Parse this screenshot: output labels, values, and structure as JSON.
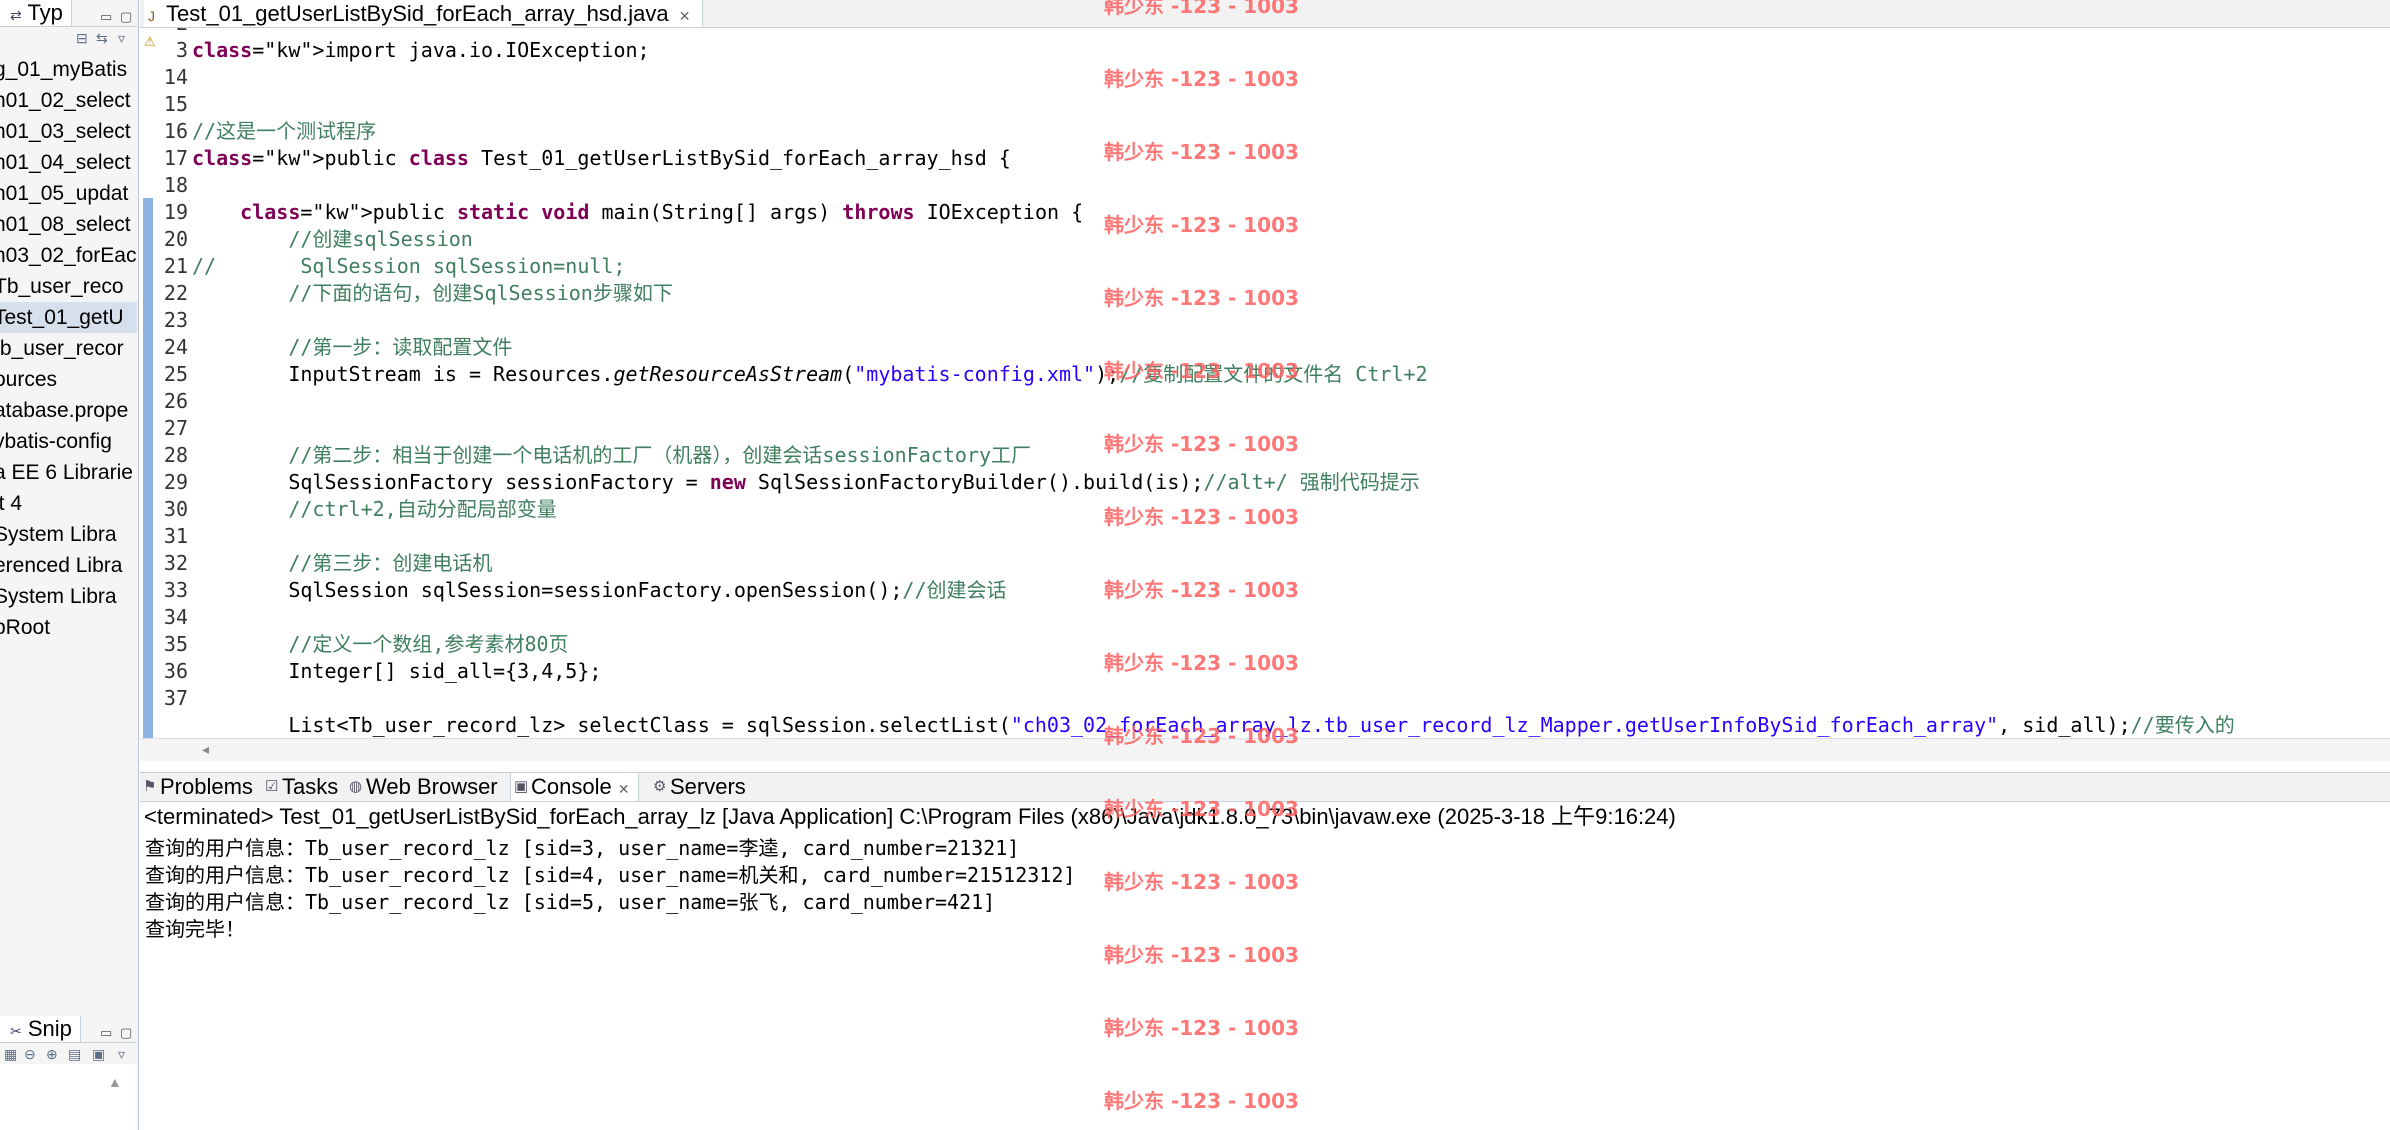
{
  "left_panel": {
    "type_tab": "Typ",
    "tree": [
      "g_01_myBatis",
      "n01_02_select",
      "n01_03_select",
      "n01_04_select",
      "n01_05_updat",
      "n01_08_select",
      "n03_02_forEac",
      "Tb_user_reco",
      "Test_01_getU",
      "tb_user_recor",
      "ources",
      "atabase.prope",
      "ybatis-config",
      "a EE 6 Librarie",
      "it 4",
      "System Libra",
      "erenced Libra",
      "System Libra",
      "bRoot"
    ],
    "selected_index": 8,
    "snip_tab": "Snip"
  },
  "editor": {
    "tab_title": "Test_01_getUserListBySid_forEach_array_hsd.java",
    "line_numbers": [
      "2",
      "3",
      "14",
      "15",
      "16",
      "17",
      "18",
      "19",
      "20",
      "21",
      "22",
      "23",
      "24",
      "25",
      "26",
      "27",
      "28",
      "29",
      "30",
      "31",
      "32",
      "33",
      "34",
      "35",
      "36",
      "37"
    ],
    "lines": [
      "",
      "import java.io.IOException;",
      "",
      "",
      "//这是一个测试程序",
      "public class Test_01_getUserListBySid_forEach_array_hsd {",
      "",
      "    public static void main(String[] args) throws IOException {",
      "        //创建sqlSession",
      "//       SqlSession sqlSession=null;",
      "        //下面的语句，创建SqlSession步骤如下",
      "",
      "        //第一步：读取配置文件",
      "        InputStream is = Resources.getResourceAsStream(\"mybatis-config.xml\");//复制配置文件的文件名 Ctrl+2",
      "",
      "",
      "        //第二步：相当于创建一个电话机的工厂（机器），创建会话sessionFactory工厂",
      "        SqlSessionFactory sessionFactory = new SqlSessionFactoryBuilder().build(is);//alt+/ 强制代码提示",
      "        //ctrl+2,自动分配局部变量",
      "",
      "        //第三步：创建电话机",
      "        SqlSession sqlSession=sessionFactory.openSession();//创建会话",
      "",
      "        //定义一个数组,参考素材80页",
      "        Integer[] sid_all={3,4,5};",
      "",
      "        List<Tb_user_record_lz> selectClass = sqlSession.selectList(\"ch03_02_forEach_array_lz.tb_user_record_lz_Mapper.getUserInfoBySid_forEach_array\", sid_all);//要传入的"
    ]
  },
  "console": {
    "tabs": [
      "Problems",
      "Tasks",
      "Web Browser",
      "Console",
      "Servers"
    ],
    "active_tab": "Console",
    "header": "<terminated> Test_01_getUserListBySid_forEach_array_lz [Java Application] C:\\Program Files (x86)\\Java\\jdk1.8.0_73\\bin\\javaw.exe (2025-3-18 上午9:16:24)",
    "output": [
      "查询的用户信息：Tb_user_record_lz [sid=3, user_name=李逵, card_number=21321]",
      "查询的用户信息：Tb_user_record_lz [sid=4, user_name=机关和, card_number=21512312]",
      "查询的用户信息：Tb_user_record_lz [sid=5, user_name=张飞, card_number=421]",
      "查询完毕！"
    ]
  },
  "watermark": {
    "text": "韩少东 -123 - 1003",
    "repeat_count": 16
  },
  "colors": {
    "keyword": "#7f0055",
    "comment": "#3f7f5f",
    "string": "#2a00ff",
    "watermark": "#ff6060",
    "selection": "#d6dfec"
  }
}
